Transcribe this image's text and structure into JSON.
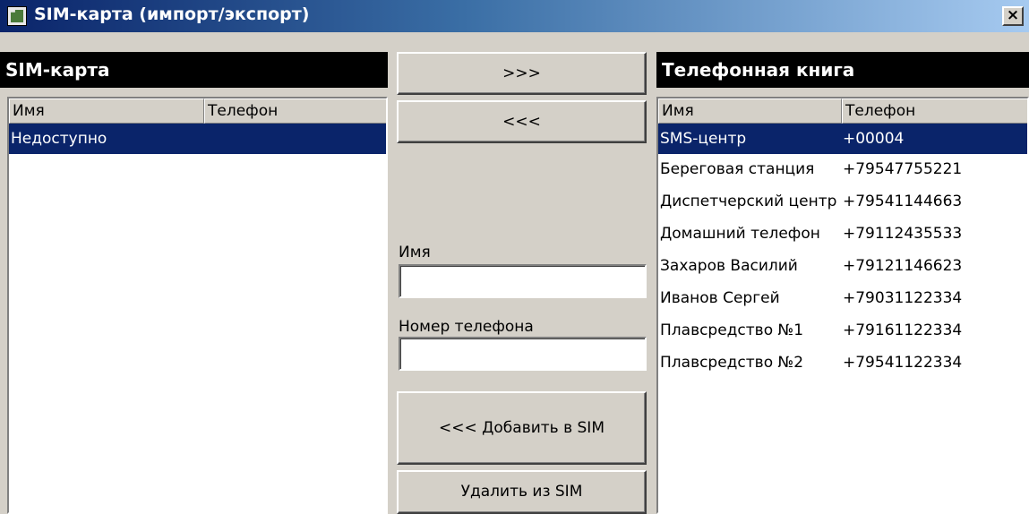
{
  "window": {
    "title": "SIM-карта (импорт/экспорт)",
    "close_glyph": "×",
    "icon": "sim-card-icon"
  },
  "sim": {
    "header": "SIM-карта",
    "columns": {
      "name": "Имя",
      "phone": "Телефон"
    },
    "rows": [
      {
        "name": "Недоступно",
        "phone": "",
        "selected": true
      }
    ]
  },
  "middle": {
    "to_phonebook_label": ">>>",
    "to_sim_label": "<<<",
    "name_label": "Имя",
    "name_value": "",
    "phone_label": "Номер телефона",
    "phone_value": "",
    "add_button": "<<< Добавить в SIM",
    "delete_button": "Удалить из SIM"
  },
  "phonebook": {
    "header": "Телефонная книга",
    "columns": {
      "name": "Имя",
      "phone": "Телефон"
    },
    "rows": [
      {
        "name": "SMS-центр",
        "phone": "+00004",
        "selected": true
      },
      {
        "name": "Береговая станция",
        "phone": "+79547755221"
      },
      {
        "name": "Диспетчерский центр",
        "phone": "+79541144663"
      },
      {
        "name": "Домашний телефон",
        "phone": "+79112435533"
      },
      {
        "name": "Захаров Василий",
        "phone": "+79121146623"
      },
      {
        "name": "Иванов Сергей",
        "phone": "+79031122334"
      },
      {
        "name": "Плавсредство №1",
        "phone": "+79161122334"
      },
      {
        "name": "Плавсредство №2",
        "phone": "+79541122334"
      }
    ]
  },
  "colors": {
    "selection": "#0a246a",
    "window_bg": "#d4d0c8",
    "header_bg": "#000000"
  }
}
